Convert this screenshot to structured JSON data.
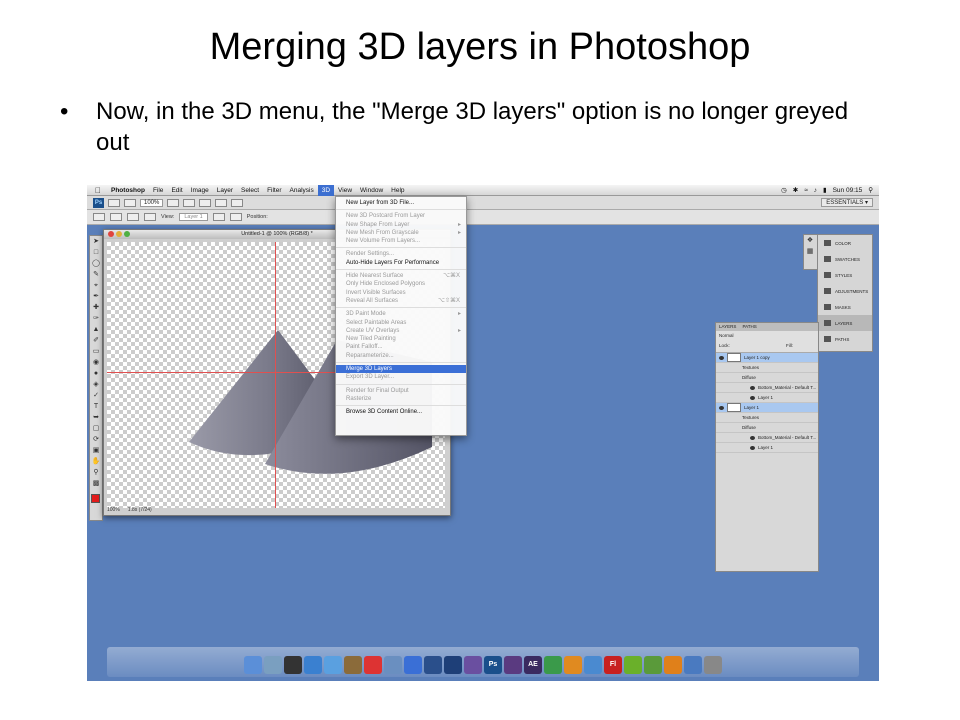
{
  "slide": {
    "title": "Merging 3D layers in Photoshop",
    "bullet_marker": "•",
    "bullet": "Now, in the 3D menu, the \"Merge 3D layers\" option is no longer greyed out"
  },
  "menubar": {
    "apple": "",
    "app_name": "Photoshop",
    "items": [
      "File",
      "Edit",
      "Image",
      "Layer",
      "Select",
      "Filter",
      "Analysis",
      "3D",
      "View",
      "Window",
      "Help"
    ],
    "active_item": "3D",
    "clock": "Sun 09:15"
  },
  "appbar": {
    "ps_logo": "Ps",
    "zoom": "100%",
    "workspace": "ESSENTIALS ▾"
  },
  "optbar": {
    "view_label": "View:",
    "view_value": "Layer 1",
    "position_label": "Position:"
  },
  "document": {
    "title": "Untitled-1 @ 100% (RGB/8) *",
    "status_zoom": "100%",
    "status_info": "1.8s (7/24)"
  },
  "menu_3d": {
    "items": [
      {
        "label": "New Layer from 3D File...",
        "enabled": true
      },
      {
        "sep": true
      },
      {
        "label": "New 3D Postcard From Layer",
        "enabled": false
      },
      {
        "label": "New Shape From Layer",
        "enabled": false,
        "submenu": true
      },
      {
        "label": "New Mesh From Grayscale",
        "enabled": false,
        "submenu": true
      },
      {
        "label": "New Volume From Layers...",
        "enabled": false
      },
      {
        "sep": true
      },
      {
        "label": "Render Settings...",
        "enabled": false
      },
      {
        "label": "Auto-Hide Layers For Performance",
        "enabled": true
      },
      {
        "sep": true
      },
      {
        "label": "Hide Nearest Surface",
        "enabled": false,
        "shortcut": "⌥⌘X"
      },
      {
        "label": "Only Hide Enclosed Polygons",
        "enabled": false
      },
      {
        "label": "Invert Visible Surfaces",
        "enabled": false
      },
      {
        "label": "Reveal All Surfaces",
        "enabled": false,
        "shortcut": "⌥⇧⌘X"
      },
      {
        "sep": true
      },
      {
        "label": "3D Paint Mode",
        "enabled": false,
        "submenu": true
      },
      {
        "label": "Select Paintable Areas",
        "enabled": false
      },
      {
        "label": "Create UV Overlays",
        "enabled": false,
        "submenu": true
      },
      {
        "label": "New Tiled Painting",
        "enabled": false
      },
      {
        "label": "Paint Falloff...",
        "enabled": false
      },
      {
        "label": "Reparameterize...",
        "enabled": false
      },
      {
        "sep": true
      },
      {
        "label": "Merge 3D Layers",
        "enabled": true,
        "highlighted": true
      },
      {
        "label": "Export 3D Layer...",
        "enabled": false
      },
      {
        "sep": true
      },
      {
        "label": "Render for Final Output",
        "enabled": false
      },
      {
        "label": "Rasterize",
        "enabled": false
      },
      {
        "sep": true
      },
      {
        "label": "Browse 3D Content Online...",
        "enabled": true
      }
    ]
  },
  "right_panel": {
    "items": [
      "COLOR",
      "SWATCHES",
      "STYLES",
      "ADJUSTMENTS",
      "MASKS",
      "LAYERS",
      "PATHS"
    ],
    "selected": "LAYERS"
  },
  "layers_panel": {
    "tabs": [
      "LAYERS",
      "PATHS"
    ],
    "blend_mode": "Normal",
    "lock_label": "Lock:",
    "fill_label": "Fill:",
    "rows": [
      {
        "label": "Layer 1 copy",
        "type": "layer",
        "selected": true
      },
      {
        "label": "Textures",
        "type": "sub"
      },
      {
        "label": "Diffuse",
        "type": "sub"
      },
      {
        "label": "Bottom_Material - Default T...",
        "type": "sub2"
      },
      {
        "label": "Layer 1",
        "type": "sub2"
      },
      {
        "label": "Layer 1",
        "type": "layer",
        "selected": true
      },
      {
        "label": "Textures",
        "type": "sub"
      },
      {
        "label": "Diffuse",
        "type": "sub"
      },
      {
        "label": "Bottom_Material - Default T...",
        "type": "sub2"
      },
      {
        "label": "Layer 1",
        "type": "sub2"
      }
    ]
  },
  "dock": {
    "icons": [
      "Finder",
      "Preview",
      "Dashboard",
      "Safari",
      "iChat",
      "Mail",
      "Calendar",
      "iPhoto",
      "iTunes",
      "Photoshop CS3",
      "Photoshop CS4",
      "Bridge",
      "Ps",
      "Premiere",
      "After Effects",
      "Chrome",
      "Illustrator",
      "Web",
      "Flash",
      "Fireworks",
      "Dreamweaver",
      "VLC",
      "Downloads",
      "Trash"
    ],
    "ps_label": "Ps",
    "ae_label": "AE",
    "fl_label": "Fl"
  },
  "colors": {
    "desktop": "#5a7fba",
    "menu_highlight": "#3b6fd6",
    "foreground_swatch": "#e31b1b"
  }
}
